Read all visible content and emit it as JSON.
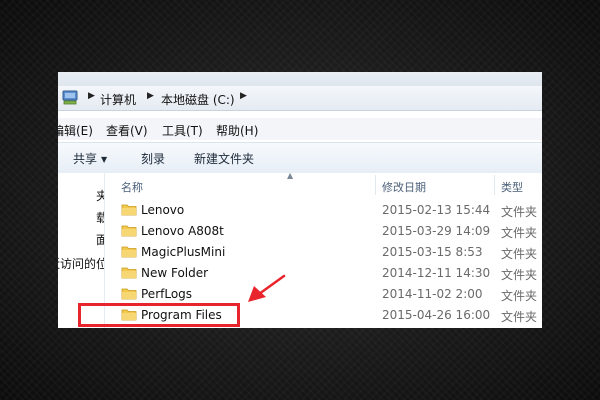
{
  "address_bar": {
    "crumbs": [
      "计算机",
      "本地磁盘 (C:)"
    ]
  },
  "menu": {
    "items": [
      "编辑(E)",
      "查看(V)",
      "工具(T)",
      "帮助(H)"
    ]
  },
  "toolbar": {
    "share": "共享",
    "burn": "刻录",
    "new_folder": "新建文件夹"
  },
  "nav_pane": {
    "items": [
      "夹",
      "载",
      "面",
      "最近访问的位"
    ]
  },
  "columns": {
    "name": "名称",
    "date": "修改日期",
    "type": "类型"
  },
  "files": [
    {
      "name": "Lenovo",
      "date": "2015-02-13 15:44",
      "type": "文件夹"
    },
    {
      "name": "Lenovo A808t",
      "date": "2015-03-29 14:09",
      "type": "文件夹"
    },
    {
      "name": "MagicPlusMini",
      "date": "2015-03-15 8:53",
      "type": "文件夹"
    },
    {
      "name": "New Folder",
      "date": "2014-12-11 14:30",
      "type": "文件夹"
    },
    {
      "name": "PerfLogs",
      "date": "2014-11-02 2:00",
      "type": "文件夹"
    },
    {
      "name": "Program Files",
      "date": "2015-04-26 16:00",
      "type": "文件夹"
    }
  ],
  "colors": {
    "highlight": "#e8242c",
    "folder": "#f2c94c"
  }
}
